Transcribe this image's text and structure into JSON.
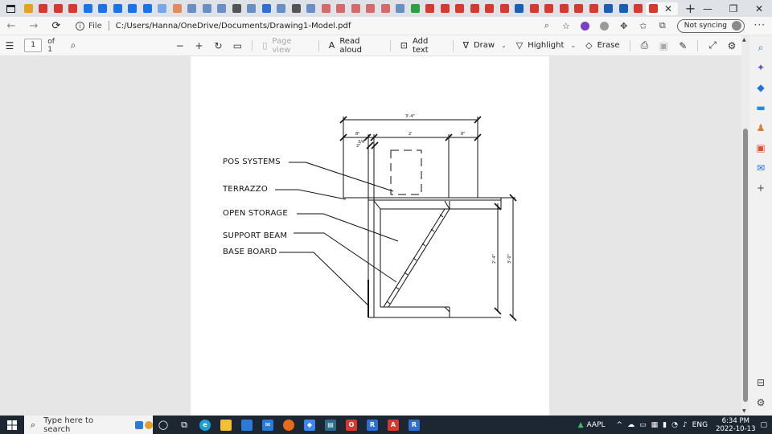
{
  "browser": {
    "tab_close": "✕",
    "new_tab": "+",
    "tab_icon_colors": [
      "#e4a020",
      "#d43a2f",
      "#d43a2f",
      "#d43a2f",
      "#1a73e8",
      "#1a73e8",
      "#1a73e8",
      "#1a73e8",
      "#1a73e8",
      "#7aa6e8",
      "#e08a60",
      "#6a8fc4",
      "#6a8fc4",
      "#6a8fc4",
      "#555555",
      "#6a8fc4",
      "#2f6fd4",
      "#6a8fc4",
      "#555555",
      "#6a8fc4",
      "#d46a6a",
      "#d46a6a",
      "#d46a6a",
      "#d46a6a",
      "#d46a6a",
      "#6a8fc4",
      "#2ea043",
      "#d43a2f",
      "#d43a2f",
      "#d43a2f",
      "#d43a2f",
      "#d43a2f",
      "#d43a2f",
      "#1a5fb4",
      "#d43a2f",
      "#d43a2f",
      "#d43a2f",
      "#d43a2f",
      "#d43a2f",
      "#1a5fb4",
      "#1a5fb4",
      "#d43a2f",
      "#d43a2f"
    ],
    "window_controls": [
      "—",
      "❐",
      "✕"
    ]
  },
  "address_bar": {
    "file_label": "File",
    "url": "C:/Users/Hanna/OneDrive/Documents/Drawing1-Model.pdf",
    "sync_label": "Not syncing"
  },
  "pdf_toolbar": {
    "page_number": "1",
    "page_of": "of 1",
    "page_view": "Page view",
    "read_aloud": "Read aloud",
    "add_text": "Add text",
    "draw": "Draw",
    "highlight": "Highlight",
    "erase": "Erase"
  },
  "drawing": {
    "labels": {
      "pos_systems": "POS SYSTEMS",
      "terrazzo": "TERRAZZO",
      "open_storage": "OPEN STORAGE",
      "support_beam": "SUPPORT BEAM",
      "base_board": "BASE BOARD"
    },
    "dimensions": {
      "overall_width": "3'-4\"",
      "left_offset": "8\"",
      "center_width": "2'",
      "right_offset": "8\"",
      "post_width": "2\"",
      "small_gap": "3/4",
      "inner_height": "2'-4\"",
      "overall_height": "3'-0\""
    }
  },
  "taskbar": {
    "search_placeholder": "Type here to search",
    "stock_ticker": "AAPL",
    "language": "ENG",
    "time": "6:34 PM",
    "date": "2022-10-13",
    "app_colors": {
      "edge": "#1f9fd6",
      "explorer": "#f2c037",
      "store": "#2b7bd6",
      "mail": "#2b7bd6",
      "firefox": "#e66b1a",
      "dropbox": "#3d86f0",
      "terminal": "#2d6b8a",
      "office": "#d43a2f",
      "r": "#2f6fd4",
      "acrobat": "#d43a2f",
      "rstudio": "#2f6fd4"
    }
  }
}
